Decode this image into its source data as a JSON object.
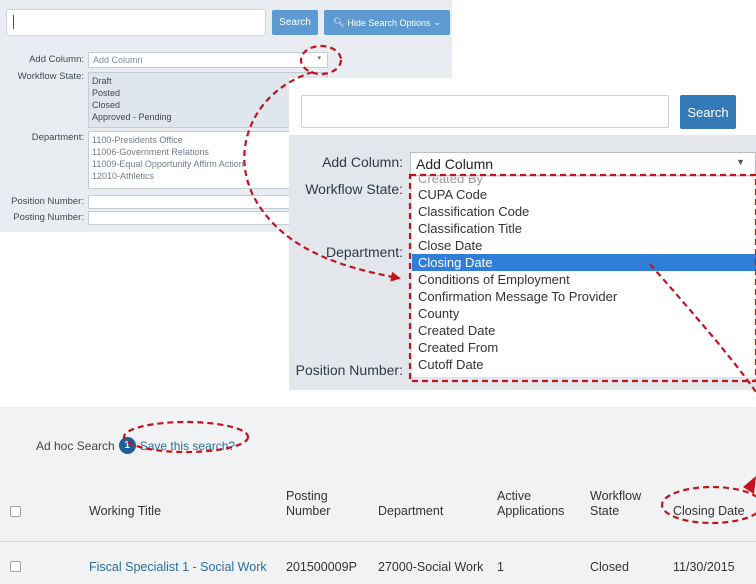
{
  "small_panel": {
    "search_button": "Search",
    "hide_options_button": "Hide Search Options",
    "add_column_label": "Add Column:",
    "add_column_placeholder": "Add Column",
    "workflow_state_label": "Workflow State:",
    "workflow_states": [
      "Draft",
      "Posted",
      "Closed",
      "Approved - Pending"
    ],
    "department_label": "Department:",
    "departments": [
      "1100-Presidents Office",
      "11006-Government Relations",
      "11009-Equal Opportunity Affirm Action",
      "12010-Athletics"
    ],
    "position_number_label": "Position Number:",
    "posting_number_label": "Posting Number:"
  },
  "zoom_panel": {
    "search_button": "Search",
    "add_column_label": "Add Column:",
    "add_column_value": "Add Column",
    "workflow_state_label": "Workflow State:",
    "department_label": "Department:",
    "position_number_label": "Position Number:",
    "cutoff_option": "Created By",
    "options": [
      "CUPA Code",
      "Classification Code",
      "Classification Title",
      "Close Date",
      "Closing Date",
      "Conditions of Employment",
      "Confirmation Message To Provider",
      "County",
      "Created Date",
      "Created From",
      "Cutoff Date"
    ],
    "selected_option": "Closing Date"
  },
  "results": {
    "title": "Ad hoc Search",
    "badge": "1",
    "save_link": "Save this search?",
    "columns": {
      "working_title": "Working Title",
      "posting_number": [
        "Posting",
        "Number"
      ],
      "department": "Department",
      "active_applications": [
        "Active",
        "Applications"
      ],
      "workflow_state": [
        "Workflow",
        "State"
      ],
      "closing_date": "Closing Date"
    },
    "rows": [
      {
        "working_title": "Fiscal Specialist 1 - Social Work",
        "posting_number": "201500009P",
        "department": "27000-Social Work",
        "active_applications": "1",
        "workflow_state": "Closed",
        "closing_date": "11/30/2015"
      }
    ]
  },
  "colors": {
    "button_blue": "#337ab7",
    "selected_option": "#2f7ed8",
    "link": "#2d6da3",
    "badge": "#1f5f98",
    "annotation_red": "#c0141e"
  }
}
